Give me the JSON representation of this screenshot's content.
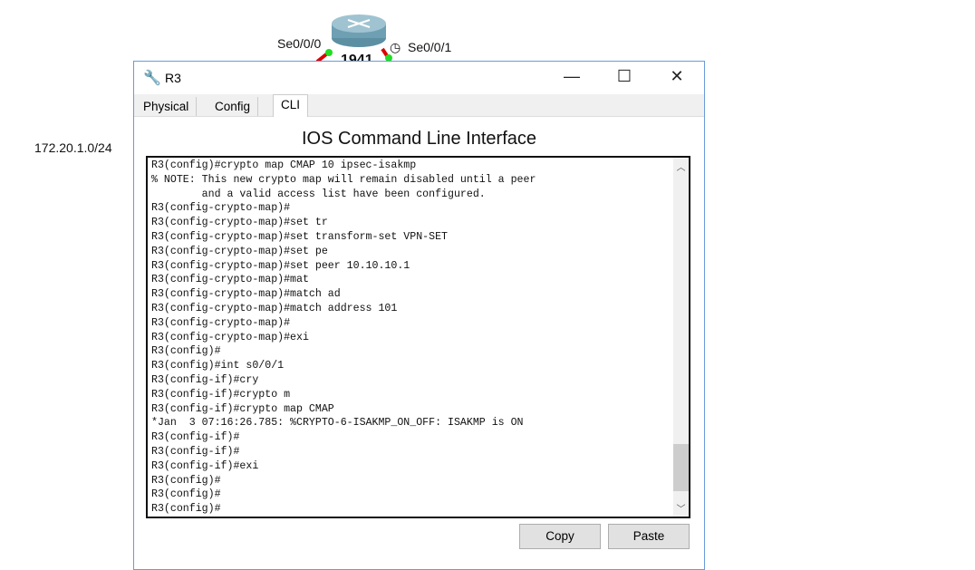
{
  "topology": {
    "interface_left": "Se0/0/0",
    "interface_right": "Se0/0/1",
    "router_model": "1941",
    "network_label": "172.20.1.0/24"
  },
  "window": {
    "title": "R3",
    "minimize": "—",
    "maximize": "☐",
    "close": "✕"
  },
  "tabs": [
    {
      "label": "Physical"
    },
    {
      "label": "Config"
    },
    {
      "label": "CLI",
      "active": true
    }
  ],
  "cli": {
    "heading": "IOS Command Line Interface",
    "lines": [
      "R3(config)#crypto map CMAP 10 ipsec-isakmp",
      "% NOTE: This new crypto map will remain disabled until a peer",
      "        and a valid access list have been configured.",
      "R3(config-crypto-map)#",
      "R3(config-crypto-map)#set tr",
      "R3(config-crypto-map)#set transform-set VPN-SET",
      "R3(config-crypto-map)#set pe",
      "R3(config-crypto-map)#set peer 10.10.10.1",
      "R3(config-crypto-map)#mat",
      "R3(config-crypto-map)#match ad",
      "R3(config-crypto-map)#match address 101",
      "R3(config-crypto-map)#",
      "R3(config-crypto-map)#exi",
      "R3(config)#",
      "R3(config)#int s0/0/1",
      "R3(config-if)#cry",
      "R3(config-if)#crypto m",
      "R3(config-if)#crypto map CMAP",
      "*Jan  3 07:16:26.785: %CRYPTO-6-ISAKMP_ON_OFF: ISAKMP is ON",
      "R3(config-if)#",
      "R3(config-if)#",
      "R3(config-if)#exi",
      "R3(config)#",
      "R3(config)#",
      "R3(config)#"
    ],
    "copy_label": "Copy",
    "paste_label": "Paste"
  }
}
